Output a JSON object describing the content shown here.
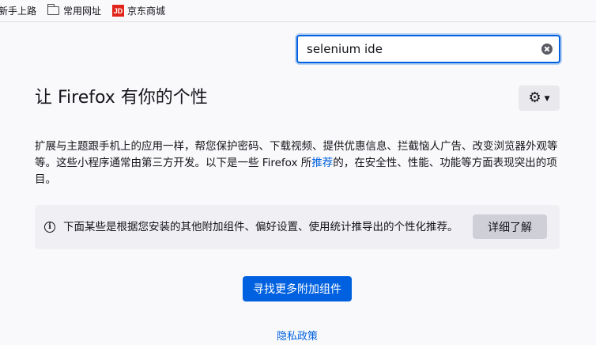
{
  "bookmarks": {
    "items": [
      {
        "label": "新手上路",
        "icon": "firefox-icon"
      },
      {
        "label": "常用网址",
        "icon": "folder-icon"
      },
      {
        "label": "京东商城",
        "icon": "jd-icon",
        "icon_text": "JD",
        "icon_color": "#e1251b"
      }
    ]
  },
  "search": {
    "value": "selenium ide",
    "clear_icon": "clear-icon"
  },
  "header": {
    "title": "让 Firefox 有你的个性",
    "gear_icon": "gear-icon",
    "gear_glyph": "⚙",
    "chevron_glyph": "▼"
  },
  "description": {
    "text_before": "扩展与主题跟手机上的应用一样，帮您保护密码、下载视频、提供优惠信息、拦截恼人广告、改变浏览器外观等等。这些小程序通常由第三方开发。以下是一些 Firefox 所",
    "link": "推荐",
    "text_after": "的，在安全性、性能、功能等方面表现突出的项目。"
  },
  "notice": {
    "icon": "info-icon",
    "icon_glyph": "i",
    "text": "下面某些是根据您安装的其他附加组件、偏好设置、使用统计推导出的个性化推荐。",
    "button": "详细了解"
  },
  "actions": {
    "find_more": "寻找更多附加组件",
    "privacy": "隐私政策"
  },
  "colors": {
    "accent": "#0061e0",
    "background": "#f9f9fb"
  }
}
